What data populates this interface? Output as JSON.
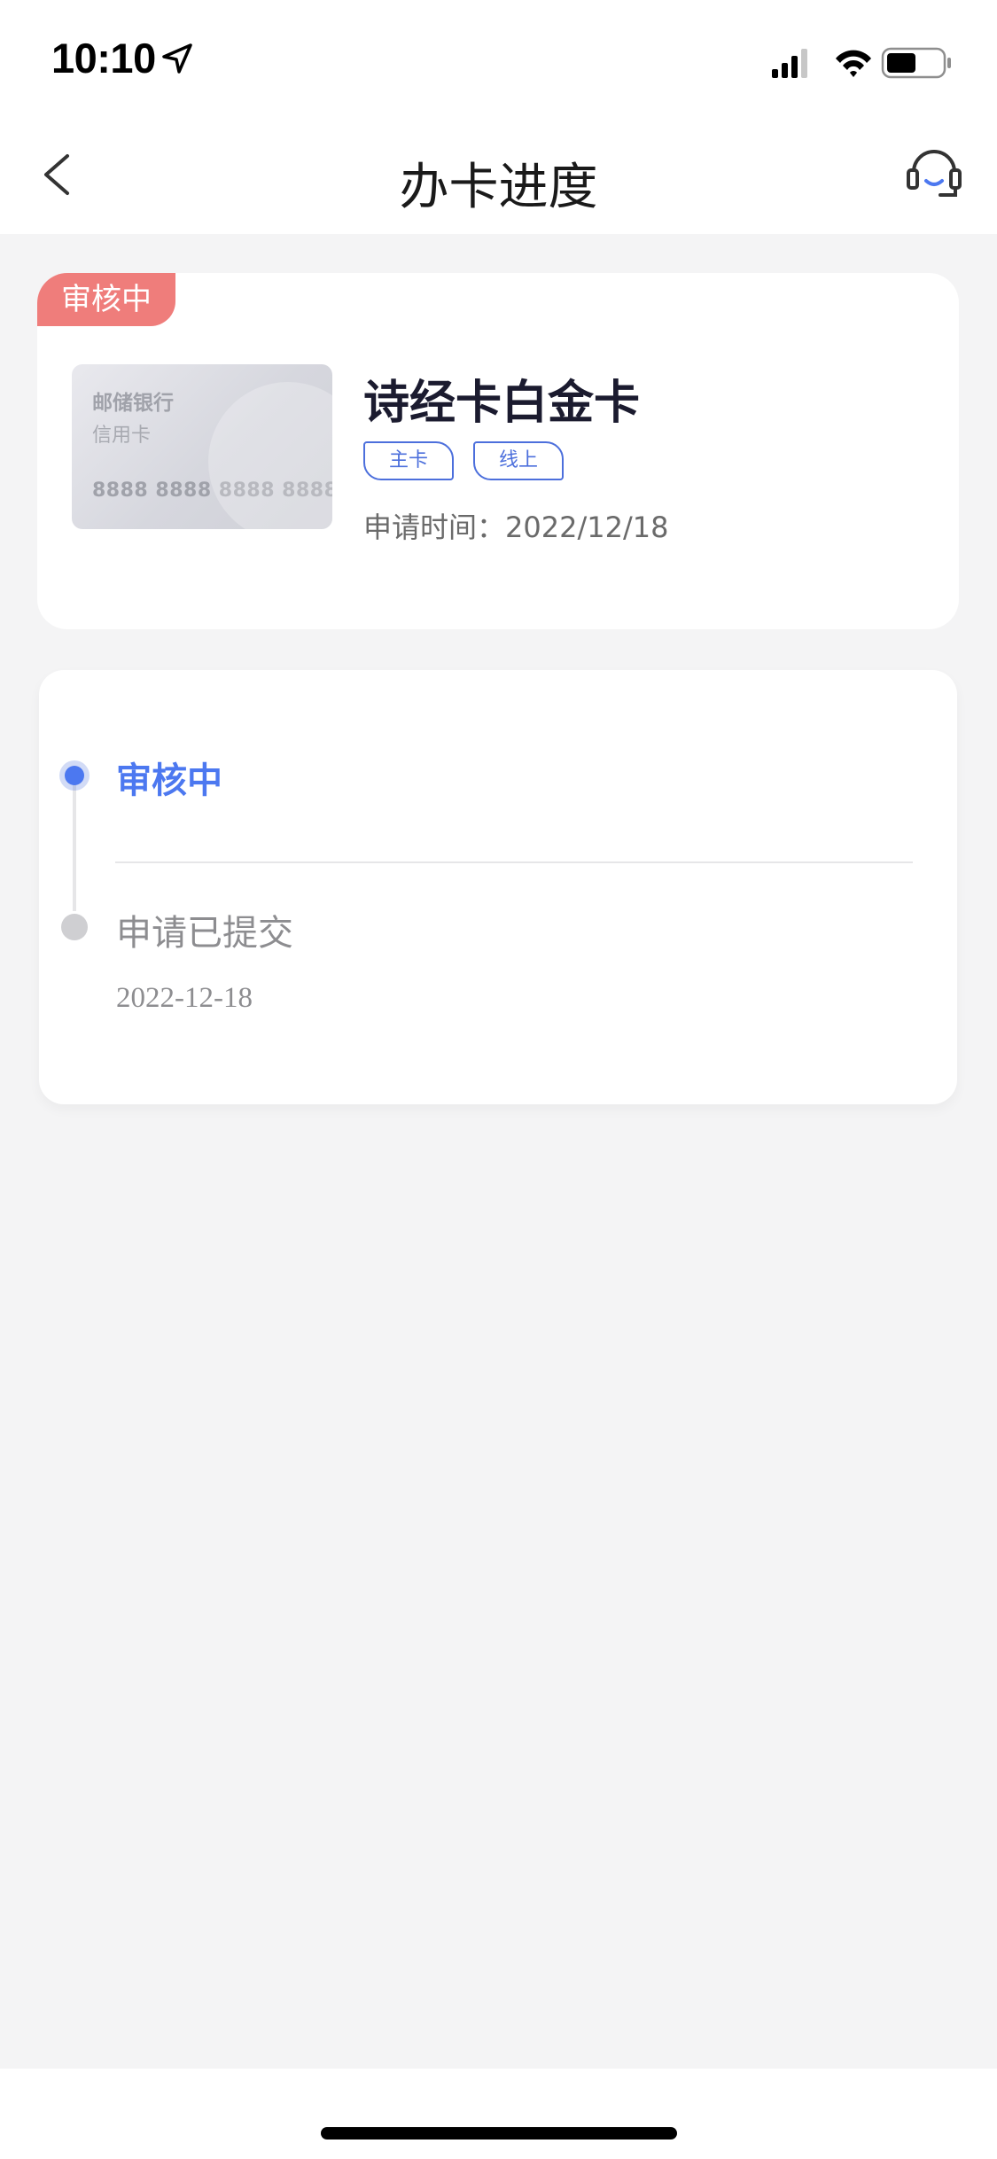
{
  "status_bar": {
    "time": "10:10"
  },
  "nav": {
    "title": "办卡进度"
  },
  "card_info": {
    "status_badge": "审核中",
    "card_image": {
      "bank": "邮储银行",
      "type": "信用卡",
      "number": "8888 8888 8888 8888"
    },
    "product_name": "诗经卡白金卡",
    "tags": [
      "主卡",
      "线上"
    ],
    "apply_time": "申请时间：2022/12/18"
  },
  "timeline": {
    "steps": [
      {
        "label": "审核中",
        "date": "",
        "active": true
      },
      {
        "label": "申请已提交",
        "date": "2022-12-18",
        "active": false
      }
    ]
  },
  "colors": {
    "accent": "#4c78f0",
    "badge": "#ef7d7b",
    "tag": "#4c6fdc"
  }
}
